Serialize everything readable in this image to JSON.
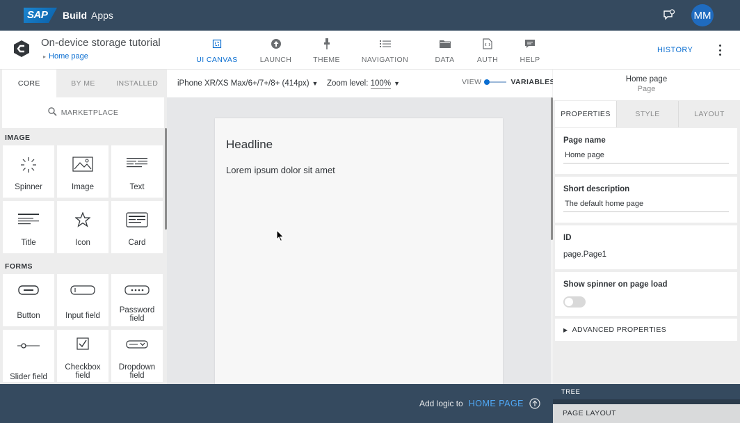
{
  "shell": {
    "logo_text": "SAP",
    "brand": "Build",
    "product": "Apps",
    "user_initials": "MM"
  },
  "app": {
    "title": "On-device storage tutorial",
    "breadcrumb": "Home page",
    "toolbar": [
      {
        "label": "UI CANVAS",
        "icon": "canvas-icon",
        "active": true
      },
      {
        "label": "LAUNCH",
        "icon": "launch-icon"
      },
      {
        "label": "THEME",
        "icon": "theme-icon"
      },
      {
        "label": "NAVIGATION",
        "icon": "navigation-icon"
      },
      {
        "label": "DATA",
        "icon": "folder-icon"
      },
      {
        "label": "AUTH",
        "icon": "auth-icon"
      },
      {
        "label": "HELP",
        "icon": "help-icon"
      }
    ],
    "history": "HISTORY"
  },
  "left": {
    "tabs": [
      "CORE",
      "BY ME",
      "INSTALLED"
    ],
    "marketplace": "MARKETPLACE",
    "sections": {
      "image": "IMAGE",
      "forms": "FORMS"
    },
    "image_items": [
      "Spinner",
      "Image",
      "Text",
      "Title",
      "Icon",
      "Card"
    ],
    "form_items": [
      "Button",
      "Input field",
      "Password field",
      "Slider field",
      "Checkbox field",
      "Dropdown field"
    ]
  },
  "canvas": {
    "device": "iPhone XR/XS Max/6+/7+/8+ (414px)",
    "zoom_label": "Zoom level:",
    "zoom_value": "100%",
    "view_label": "VIEW",
    "variables_label": "VARIABLES",
    "headline": "Headline",
    "body": "Lorem ipsum dolor sit amet"
  },
  "right": {
    "component_name": "Home page",
    "component_type": "Page",
    "tabs": [
      "PROPERTIES",
      "STYLE",
      "LAYOUT"
    ],
    "page_name_label": "Page name",
    "page_name_value": "Home page",
    "short_desc_label": "Short description",
    "short_desc_value": "The default home page",
    "id_label": "ID",
    "id_value": "page.Page1",
    "spinner_label": "Show spinner on page load",
    "advanced": "ADVANCED PROPERTIES"
  },
  "bottom": {
    "add_logic_label": "Add logic to",
    "add_logic_target": "HOME PAGE",
    "tree_label": "TREE",
    "page_layout_label": "PAGE LAYOUT"
  },
  "colors": {
    "shell": "#354a5f",
    "accent": "#0a6ed1"
  }
}
